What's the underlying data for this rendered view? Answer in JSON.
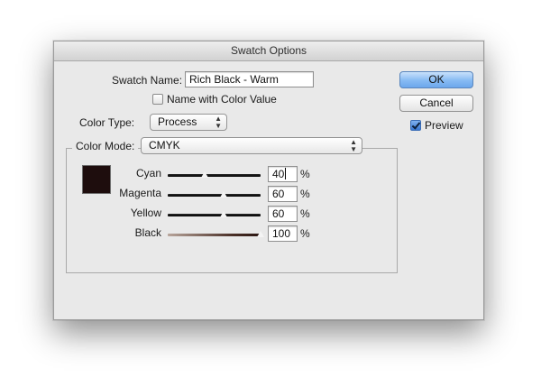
{
  "dialog": {
    "title": "Swatch Options",
    "swatch_name_label": "Swatch Name:",
    "swatch_name_value": "Rich Black - Warm",
    "name_with_color_value_label": "Name with Color Value",
    "name_with_color_value_checked": false,
    "color_type_label": "Color Type:",
    "color_type_value": "Process",
    "color_mode_label": "Color Mode:",
    "color_mode_value": "CMYK",
    "swatch_color": "#1e0d0d",
    "sliders": [
      {
        "label": "Cyan",
        "value": "40",
        "unit": "%",
        "fraction": 0.4
      },
      {
        "label": "Magenta",
        "value": "60",
        "unit": "%",
        "fraction": 0.6
      },
      {
        "label": "Yellow",
        "value": "60",
        "unit": "%",
        "fraction": 0.6
      },
      {
        "label": "Black",
        "value": "100",
        "unit": "%",
        "fraction": 1.0
      }
    ],
    "buttons": {
      "ok": "OK",
      "cancel": "Cancel"
    },
    "preview_label": "Preview",
    "preview_checked": true
  },
  "colors": {
    "accent": "#6ca7ec",
    "dialog_bg": "#e9e9e9"
  }
}
